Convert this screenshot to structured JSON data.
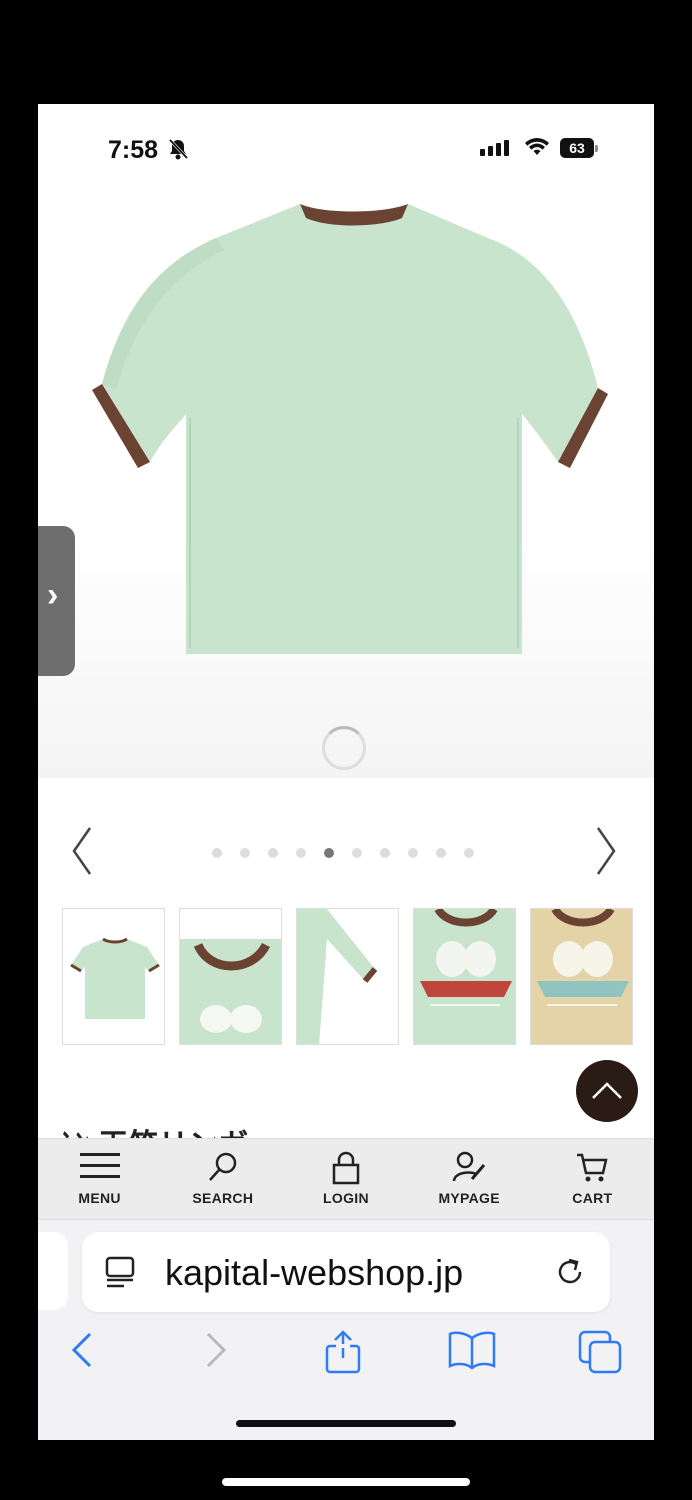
{
  "status_bar": {
    "time": "7:58",
    "battery": "63"
  },
  "product": {
    "heading_partial": "ｼﾝ 天竺リンガ"
  },
  "carousel": {
    "dot_count": 10,
    "active_index": 4
  },
  "nav": [
    {
      "label": "MENU"
    },
    {
      "label": "SEARCH"
    },
    {
      "label": "LOGIN"
    },
    {
      "label": "MYPAGE"
    },
    {
      "label": "CART"
    }
  ],
  "browser": {
    "url": "kapital-webshop.jp"
  },
  "colors": {
    "shirt": "#c9e4cd",
    "trim": "#6b4332",
    "accent": "#2a1b15",
    "ios_blue": "#2f7bf5"
  }
}
